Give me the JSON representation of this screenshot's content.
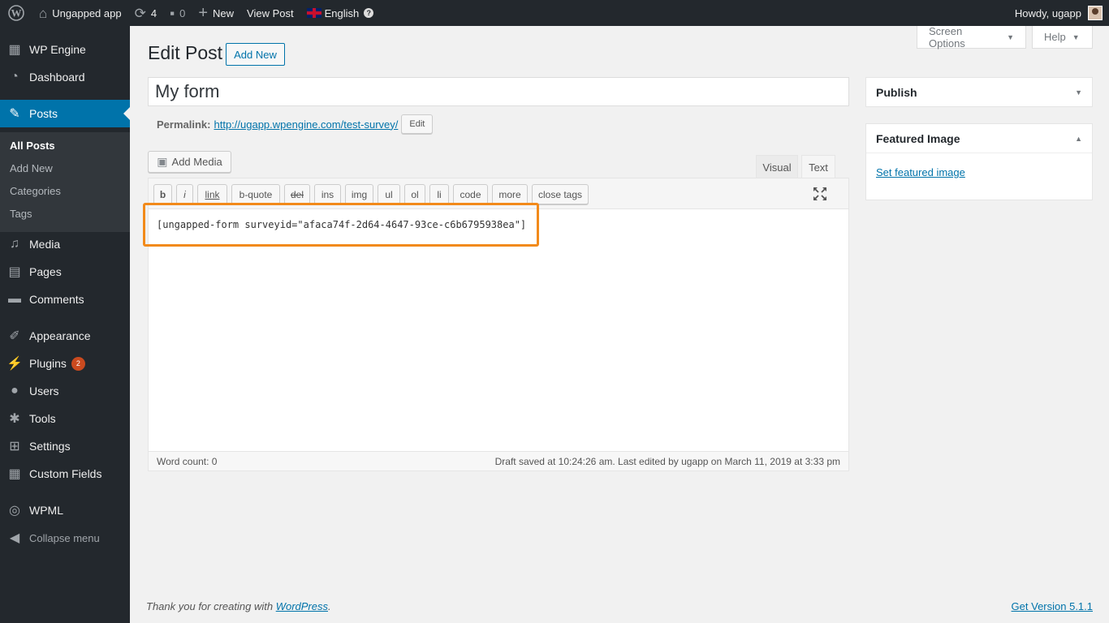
{
  "adminbar": {
    "site_name": "Ungapped app",
    "updates_count": "4",
    "comments_count": "0",
    "new_label": "New",
    "view_post_label": "View Post",
    "language_label": "English",
    "greeting": "Howdy, ugapp"
  },
  "sidebar": {
    "items": [
      {
        "label": "WP Engine",
        "icon": "wpengine-icon"
      },
      {
        "label": "Dashboard",
        "icon": "dashboard-icon"
      },
      {
        "label": "Posts",
        "icon": "pin-icon"
      },
      {
        "label": "Media",
        "icon": "media-icon"
      },
      {
        "label": "Pages",
        "icon": "pages-icon"
      },
      {
        "label": "Comments",
        "icon": "comments-icon"
      },
      {
        "label": "Appearance",
        "icon": "brush-icon"
      },
      {
        "label": "Plugins",
        "icon": "plugin-icon"
      },
      {
        "label": "Users",
        "icon": "user-icon"
      },
      {
        "label": "Tools",
        "icon": "wrench-icon"
      },
      {
        "label": "Settings",
        "icon": "settings-icon"
      },
      {
        "label": "Custom Fields",
        "icon": "grid-icon"
      },
      {
        "label": "WPML",
        "icon": "wpml-icon"
      },
      {
        "label": "Collapse menu",
        "icon": "collapse-icon"
      }
    ],
    "posts_submenu": [
      "All Posts",
      "Add New",
      "Categories",
      "Tags"
    ],
    "plugins_badge": "2"
  },
  "header": {
    "screen_options": "Screen Options",
    "help": "Help",
    "page_title": "Edit Post",
    "add_new": "Add New"
  },
  "post": {
    "title": "My form",
    "permalink_label": "Permalink:",
    "permalink_url": "http://ugapp.wpengine.com/test-survey/",
    "permalink_edit": "Edit",
    "add_media": "Add Media",
    "tab_visual": "Visual",
    "tab_text": "Text",
    "content": "[ungapped-form surveyid=\"afaca74f-2d64-4647-93ce-c6b6795938ea\"]",
    "word_count": "Word count: 0",
    "draft_status": "Draft saved at 10:24:26 am. Last edited by ugapp on March 11, 2019 at 3:33 pm"
  },
  "toolbar": {
    "buttons": [
      "b",
      "i",
      "link",
      "b-quote",
      "del",
      "ins",
      "img",
      "ul",
      "ol",
      "li",
      "code",
      "more",
      "close tags"
    ]
  },
  "metaboxes": {
    "publish_title": "Publish",
    "featured_title": "Featured Image",
    "featured_link": "Set featured image"
  },
  "footer": {
    "thanks_prefix": "Thank you for creating with ",
    "thanks_link": "WordPress",
    "thanks_suffix": ".",
    "version_link": "Get Version 5.1.1"
  },
  "colors": {
    "admin_bar": "#23282d",
    "accent": "#0073aa",
    "highlight": "#f28a1a",
    "badge": "#ca4a1f"
  }
}
